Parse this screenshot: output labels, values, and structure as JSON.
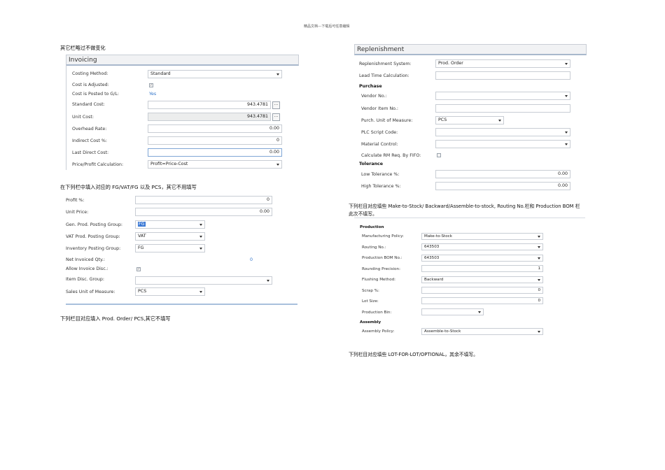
{
  "header_note": "精品文档---下载后可任意编辑",
  "left": {
    "note1": "其它栏略过不做变化",
    "invoicing": {
      "title": "Invoicing",
      "costing_method": {
        "label": "Costing Method:",
        "value": "Standard"
      },
      "cost_is_adjusted": {
        "label": "Cost is Adjusted:",
        "checked": true
      },
      "cost_posted_gl": {
        "label": "Cost is Posted to G/L:",
        "value": "Yes"
      },
      "standard_cost": {
        "label": "Standard Cost:",
        "value": "943.4781"
      },
      "unit_cost": {
        "label": "Unit Cost:",
        "value": "943.4781"
      },
      "overhead_rate": {
        "label": "Overhead Rate:",
        "value": "0.00"
      },
      "indirect_cost": {
        "label": "Indirect Cost %:",
        "value": "0"
      },
      "last_direct_cost": {
        "label": "Last Direct Cost:",
        "value": "0.00"
      },
      "price_profit": {
        "label": "Price/Profit Calculation:",
        "value": "Profit=Price-Cost"
      }
    },
    "note2": "在下列栏中填入对应的 FG/VAT/FG 以及 PCS，其它不用填写",
    "sales": {
      "profit": {
        "label": "Profit %:",
        "value": "0"
      },
      "unit_price": {
        "label": "Unit Price:",
        "value": "0.00"
      },
      "gen_prod": {
        "label": "Gen. Prod. Posting Group:",
        "value": "FG"
      },
      "vat_prod": {
        "label": "VAT Prod. Posting Group:",
        "value": "VAT"
      },
      "inv_posting": {
        "label": "Inventory Posting Group:",
        "value": "FG"
      },
      "net_invoiced": {
        "label": "Net Invoiced Qty.:",
        "value": "0"
      },
      "allow_invoice": {
        "label": "Allow Invoice Disc.:",
        "checked": true
      },
      "item_disc": {
        "label": "Item Disc. Group:",
        "value": ""
      },
      "sales_uom": {
        "label": "Sales Unit of Measure:",
        "value": "PCS"
      }
    },
    "note3": "下列栏目对应填入 Prod. Order/ PCS,其它不填写"
  },
  "right": {
    "replenishment": {
      "title": "Replenishment",
      "system": {
        "label": "Replenishment System:",
        "value": "Prod. Order"
      },
      "lead_time": {
        "label": "Lead Time Calculation:",
        "value": ""
      },
      "purchase_heading": "Purchase",
      "vendor_no": {
        "label": "Vendor No.:",
        "value": ""
      },
      "vendor_item": {
        "label": "Vendor Item No.:",
        "value": ""
      },
      "purch_uom": {
        "label": "Purch. Unit of Measure:",
        "value": "PCS"
      },
      "plc_script": {
        "label": "PLC Script Code:",
        "value": ""
      },
      "material_control": {
        "label": "Material Control:",
        "value": ""
      },
      "calc_rm": {
        "label": "Calculate RM Req. By FIFO:",
        "checked": false
      },
      "tolerance_heading": "Tolerance",
      "low_tol": {
        "label": "Low Tolerance %:",
        "value": "0.00"
      },
      "high_tol": {
        "label": "High Tolerance %:",
        "value": "0.00"
      }
    },
    "note4_line1": "下列栏目对应填些 Make-to-Stock/ Backward/Assemble-to-stock, Routing No.栏和 Production BOM 栏",
    "note4_line2": "此次不填写。",
    "production": {
      "heading": "Production",
      "manufacturing_policy": {
        "label": "Manufacturing Policy:",
        "value": "Make-to-Stock"
      },
      "routing_no": {
        "label": "Routing No.:",
        "value": "643503"
      },
      "prod_bom": {
        "label": "Production BOM No.:",
        "value": "643503"
      },
      "rounding": {
        "label": "Rounding Precision:",
        "value": "1"
      },
      "flushing": {
        "label": "Flushing Method:",
        "value": "Backward"
      },
      "scrap": {
        "label": "Scrap %:",
        "value": "0"
      },
      "lot_size": {
        "label": "Lot Size:",
        "value": "0"
      },
      "prod_bin": {
        "label": "Production Bin:",
        "value": ""
      },
      "assembly_heading": "Assembly",
      "assembly_policy": {
        "label": "Assembly Policy:",
        "value": "Assemble-to-Stock"
      }
    },
    "note5": "下列栏目对应填些 LOT-FOR-LOT/OPTIONAL，其余不填写。"
  }
}
